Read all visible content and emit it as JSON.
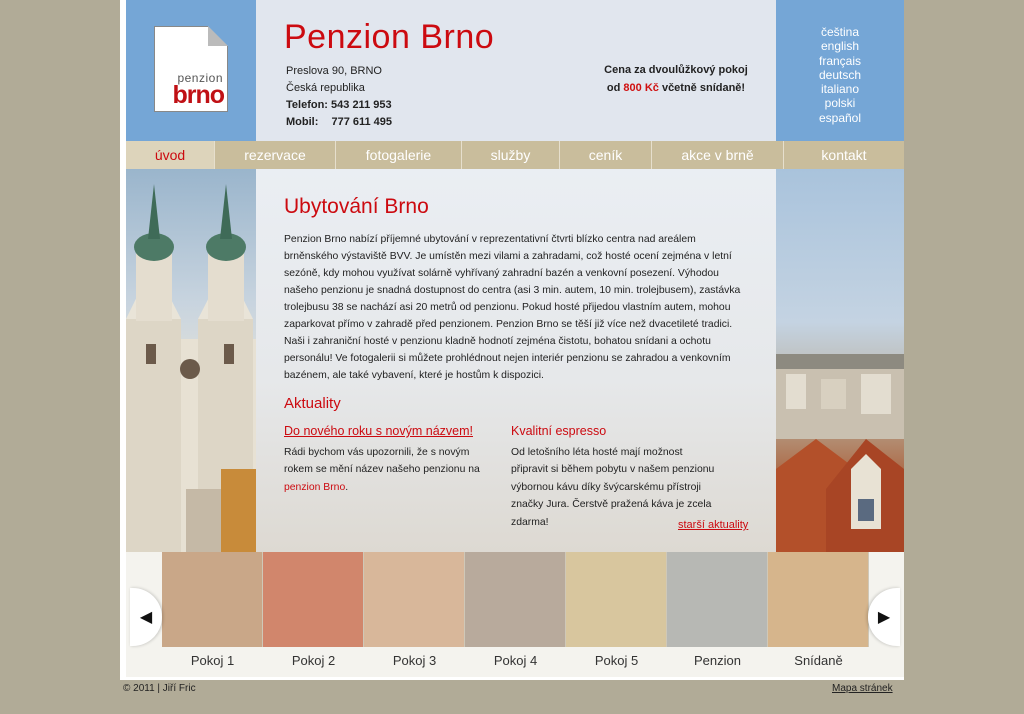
{
  "header": {
    "logo": {
      "line1": "penzion",
      "line2": "brno"
    },
    "title": "Penzion Brno",
    "address": {
      "street": "Preslova 90, BRNO",
      "country": "Česká republika",
      "phone_label": "Telefon:",
      "phone": "543 211 953",
      "mobile_label": "Mobil:",
      "mobile": "777 611 495"
    },
    "promo": {
      "line1": "Cena za dvoulůžkový pokoj",
      "line2_pre": "od ",
      "price": "800 Kč",
      "line2_post": " včetně snídaně!"
    },
    "languages": [
      "čeština",
      "english",
      "français",
      "deutsch",
      "italiano",
      "polski",
      "español"
    ]
  },
  "nav": {
    "items": [
      {
        "label": "úvod",
        "active": true
      },
      {
        "label": "rezervace"
      },
      {
        "label": "fotogalerie"
      },
      {
        "label": "služby"
      },
      {
        "label": "ceník"
      },
      {
        "label": "akce v brně"
      },
      {
        "label": "kontakt"
      }
    ]
  },
  "main": {
    "heading": "Ubytování Brno",
    "intro": "Penzion Brno nabízí příjemné ubytování v reprezentativní čtvrti blízko centra nad areálem brněnského výstaviště BVV. Je umístěn mezi vilami a zahradami, což hosté ocení zejména v letní sezóně, kdy mohou využívat solárně vyhřívaný zahradní bazén a venkovní posezení. Výhodou našeho penzionu je snadná dostupnost do centra (asi 3 min. autem, 10 min. trolejbusem), zastávka trolejbusu 38 se nachází asi 20 metrů od penzionu. Pokud hosté přijedou vlastním autem, mohou zaparkovat přímo v zahradě před penzionem. Penzion Brno se těší již více než dvacetileté tradici. Naši i zahraniční hosté v penzionu kladně hodnotí zejména čistotu, bohatou snídani a ochotu personálu! Ve fotogalerii si můžete prohlédnout nejen interiér penzionu se zahradou a venkovním bazénem, ale také vybavení, které je hostům k dispozici.",
    "news_heading": "Aktuality",
    "news": [
      {
        "title": "Do nového roku s novým názvem!",
        "text": "Rádi bychom vás upozornili, že s novým rokem se mění název našeho penzionu na ",
        "highlight": "penzion Brno",
        "end": "."
      },
      {
        "title": "Kvalitní espresso",
        "text": "Od letošního léta hosté mají možnost připravit si během pobytu v našem penzionu výbornou kávu díky švýcarskému přístroji značky Jura. Čerstvě pražená káva je zcela zdarma!"
      }
    ],
    "older_news": "starší aktuality"
  },
  "gallery": {
    "items": [
      {
        "caption": "Pokoj 1",
        "color": "#c9a788"
      },
      {
        "caption": "Pokoj 2",
        "color": "#d1866c"
      },
      {
        "caption": "Pokoj 3",
        "color": "#d8b79a"
      },
      {
        "caption": "Pokoj 4",
        "color": "#b8aa9c"
      },
      {
        "caption": "Pokoj 5",
        "color": "#d8c69e"
      },
      {
        "caption": "Penzion",
        "color": "#b7b8b4"
      },
      {
        "caption": "Snídaně",
        "color": "#d6b58c"
      }
    ],
    "prev_icon": "◀",
    "next_icon": "▶"
  },
  "footer": {
    "copyright": "© 2011 | Jiří Fric",
    "sitemap": "Mapa stránek"
  },
  "colors": {
    "accent": "#cc0a10",
    "header_blue": "#75a6d6",
    "nav_tan": "#c9bd9c",
    "page_bg": "#b1ab97"
  }
}
